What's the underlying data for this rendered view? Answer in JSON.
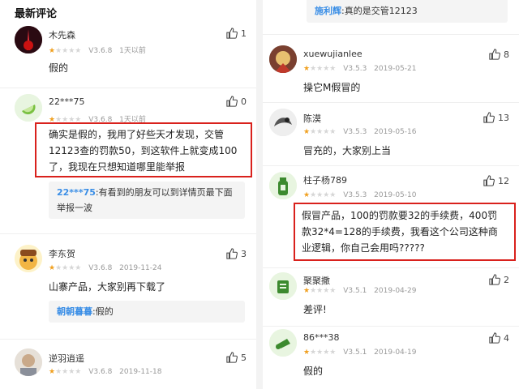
{
  "left": {
    "section_title": "最新评论",
    "comments": [
      {
        "user": "木先森",
        "version": "V3.6.8",
        "time": "1天以前",
        "likes": "1",
        "text": "假的",
        "stars": 1
      },
      {
        "user": "22***75",
        "version": "V3.6.8",
        "time": "1天以前",
        "likes": "0",
        "text": "确实是假的，我用了好些天才发现，交管12123查的罚款50，到这软件上就变成100了，我现在只想知道哪里能举报",
        "reply_user": "22***75",
        "reply_text": ":有看到的朋友可以到详情页最下面举报一波",
        "stars": 1
      },
      {
        "user": "李东贺",
        "version": "V3.6.8",
        "time": "2019-11-24",
        "likes": "3",
        "text": "山寨产品，大家别再下载了",
        "reply_user": "朝朝暮暮",
        "reply_text": ":假的",
        "stars": 1
      },
      {
        "user": "逆羽逍遥",
        "version": "V3.6.8",
        "time": "2019-11-18",
        "likes": "5",
        "stars": 1
      }
    ]
  },
  "right": {
    "top_reply": {
      "user": "施利辉",
      "text": ":真的是交管12123"
    },
    "comments": [
      {
        "user": "xuewujianlee",
        "version": "V3.5.3",
        "time": "2019-05-21",
        "likes": "8",
        "text": "操它M假冒的",
        "stars": 1
      },
      {
        "user": "陈漠",
        "version": "V3.5.3",
        "time": "2019-05-16",
        "likes": "13",
        "text": "冒充的，大家别上当",
        "stars": 1
      },
      {
        "user": "柱子杨789",
        "version": "V3.5.3",
        "time": "2019-05-10",
        "likes": "12",
        "text": "假冒产品，100的罚款要32的手续费，400罚款32*4=128的手续费，我看这个公司这种商业逻辑，你自己会用吗?????",
        "stars": 1
      },
      {
        "user": "聚聚撒",
        "version": "V3.5.1",
        "time": "2019-04-29",
        "likes": "2",
        "text": "差评!",
        "stars": 1
      },
      {
        "user": "86***38",
        "version": "V3.5.1",
        "time": "2019-04-19",
        "likes": "4",
        "text": "假的",
        "stars": 1
      }
    ]
  },
  "colors": {
    "highlight": "#d9211c",
    "reply_name": "#3a8ee6",
    "star": "#f0a020"
  },
  "icons": {
    "like": "thumbs-up-icon"
  }
}
